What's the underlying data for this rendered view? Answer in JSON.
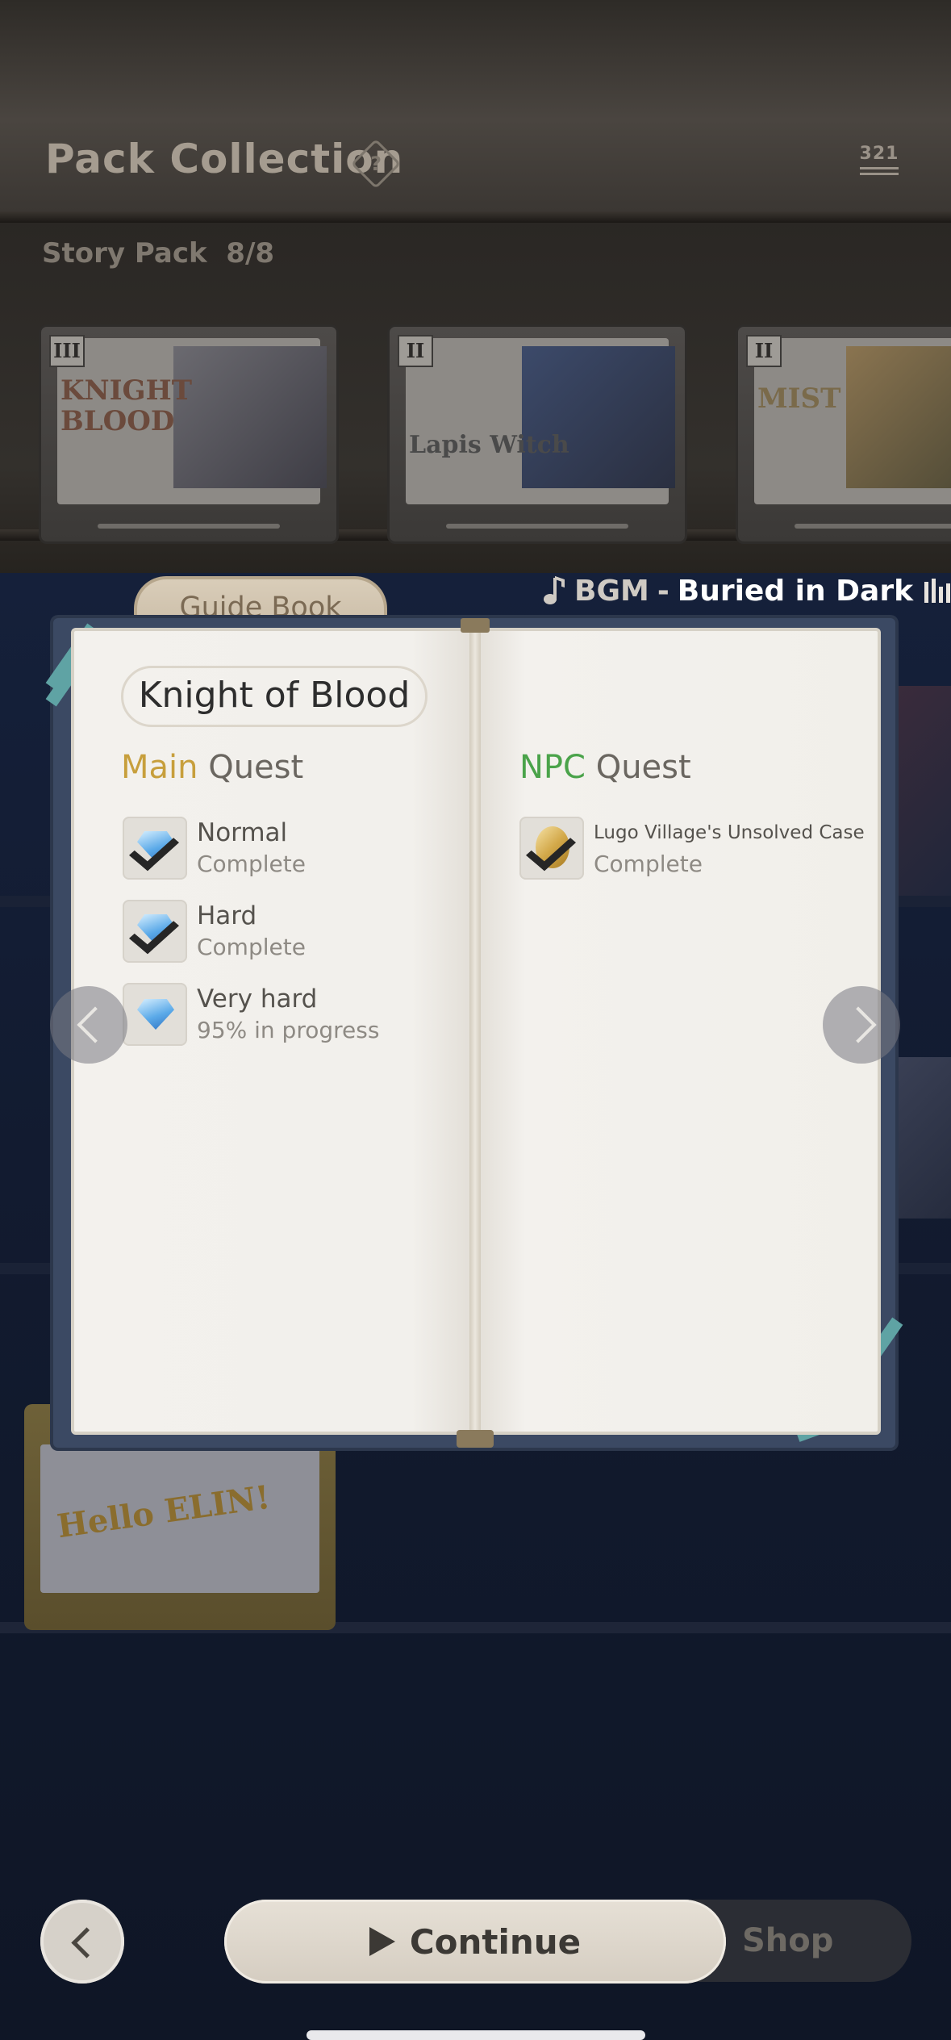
{
  "header": {
    "title": "Pack Collection",
    "help_glyph": "?",
    "sort_label": "321"
  },
  "story_pack": {
    "label": "Story Pack",
    "count": "8/8",
    "cartridges": [
      {
        "numeral": "III",
        "logo": "KNIGHT\nBLOOD"
      },
      {
        "numeral": "II",
        "logo": "Lapis Witch"
      },
      {
        "numeral": "II",
        "logo": "MIST"
      }
    ]
  },
  "bottom_cartridge": {
    "logo": "Hello ELIN!"
  },
  "bgm": {
    "label": "BGM",
    "separator": "-",
    "track": "Buried in Dark"
  },
  "guide_book": {
    "tab_label": "Guide Book",
    "title": "Knight of Blood",
    "main_quest": {
      "heading_highlight": "Main",
      "heading_rest": "Quest",
      "items": [
        {
          "name": "Normal",
          "status": "Complete",
          "icon": "diamond-check-icon"
        },
        {
          "name": "Hard",
          "status": "Complete",
          "icon": "diamond-check-icon"
        },
        {
          "name": "Very hard",
          "status": "95% in progress",
          "icon": "diamond-icon"
        }
      ]
    },
    "npc_quest": {
      "heading_highlight": "NPC",
      "heading_rest": "Quest",
      "items": [
        {
          "name": "Lugo Village's Unsolved Case",
          "status": "Complete",
          "icon": "coin-check-icon"
        }
      ]
    }
  },
  "bottom_bar": {
    "continue_label": "Continue",
    "shop_label": "Shop"
  },
  "colors": {
    "main_accent": "#c79f3c",
    "npc_accent": "#4aa34a",
    "book_cover": "#3b4963"
  }
}
